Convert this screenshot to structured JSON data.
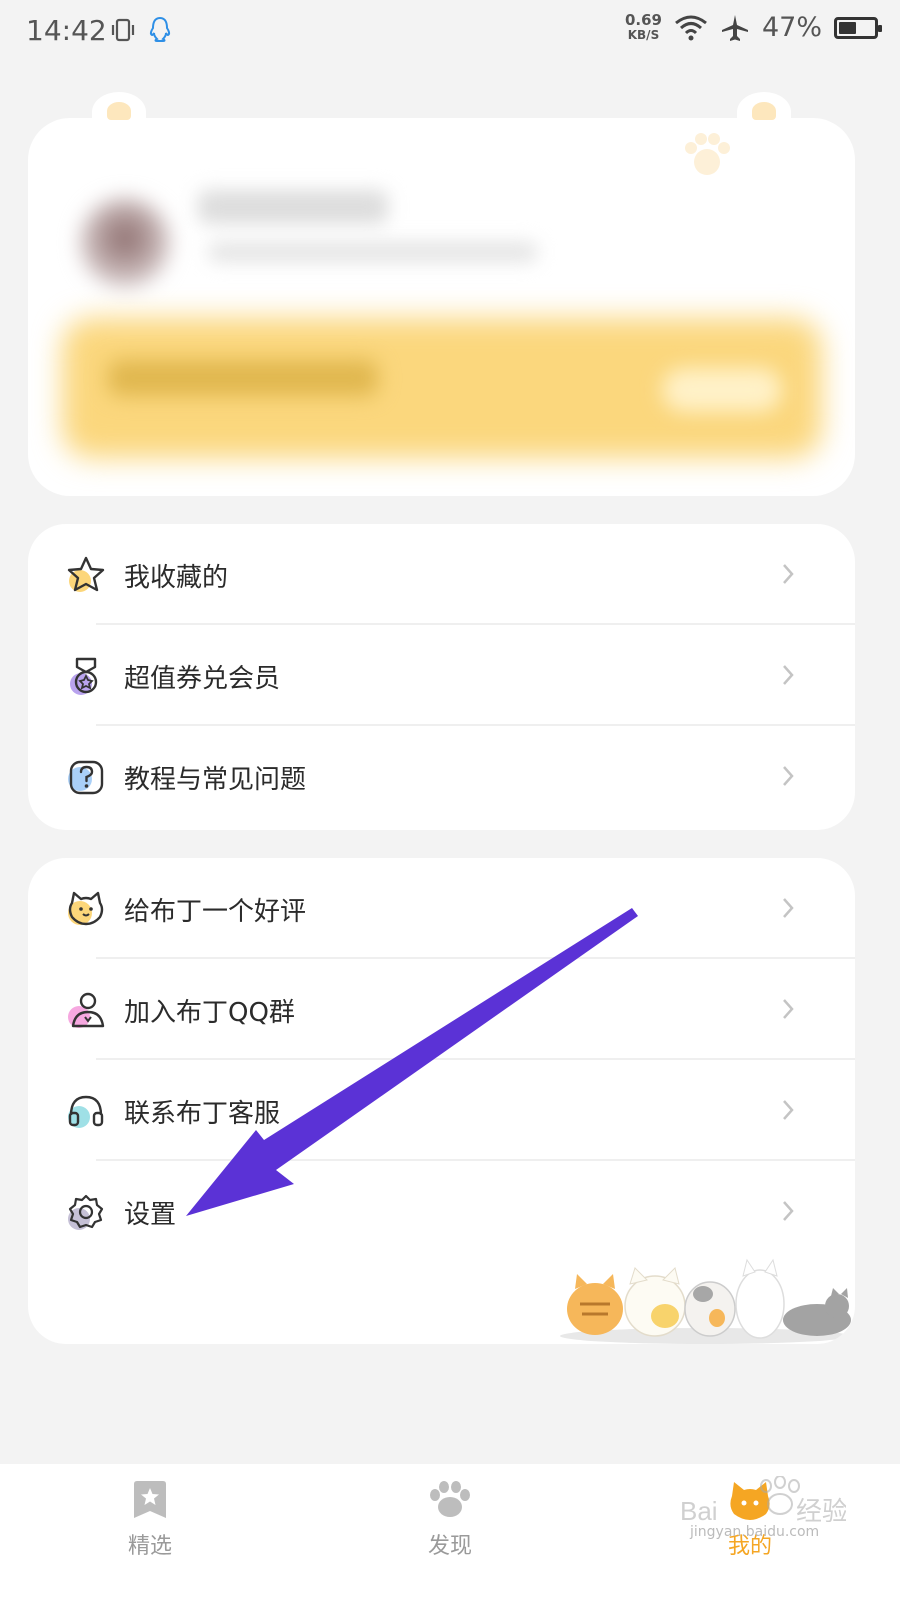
{
  "status_bar": {
    "time": "14:42",
    "net_speed_value": "0.69",
    "net_speed_unit": "KB/S",
    "battery_percent": "47%"
  },
  "profile_card": {
    "blurred": true
  },
  "menu_section_1": {
    "items": [
      {
        "label": "我收藏的",
        "icon": "star-icon"
      },
      {
        "label": "超值券兑会员",
        "icon": "medal-icon"
      },
      {
        "label": "教程与常见问题",
        "icon": "question-icon"
      }
    ]
  },
  "menu_section_2": {
    "items": [
      {
        "label": "给布丁一个好评",
        "icon": "cat-face-icon"
      },
      {
        "label": "加入布丁QQ群",
        "icon": "user-group-icon"
      },
      {
        "label": "联系布丁客服",
        "icon": "headset-icon"
      },
      {
        "label": "设置",
        "icon": "gear-icon"
      }
    ]
  },
  "bottom_nav": {
    "tabs": [
      {
        "label": "精选",
        "icon": "bookmark-star-icon",
        "active": false
      },
      {
        "label": "发现",
        "icon": "paw-icon",
        "active": false
      },
      {
        "label": "我的",
        "icon": "cat-head-icon",
        "active": true
      }
    ]
  },
  "watermark": {
    "text": "jingyan.baidu.com"
  },
  "colors": {
    "accent": "#f5a623",
    "arrow": "#5b32d6",
    "banner": "#fbd77d",
    "background": "#f3f3f3"
  }
}
